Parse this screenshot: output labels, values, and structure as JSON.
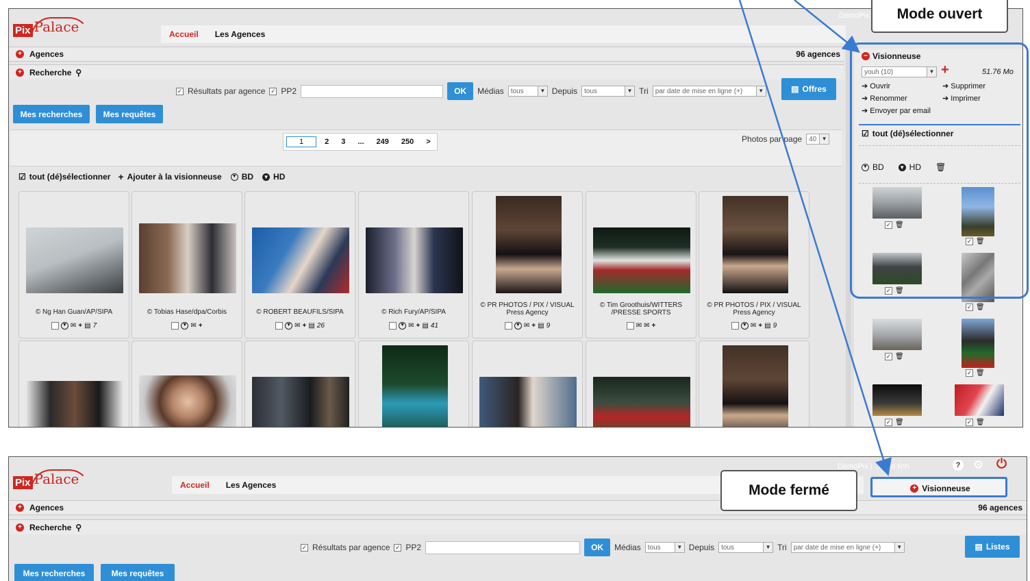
{
  "app": {
    "logo_pix": "Pix",
    "logo_palace": "Palace"
  },
  "top": {
    "user": "DemoPix",
    "tabs": [
      "Accueil",
      "Les Agences"
    ],
    "agences_label": "Agences",
    "agences_count": "96 agences",
    "recherche_label": "Recherche",
    "search": {
      "par_agence": "Résultats par agence",
      "pp2": "PP2",
      "ok": "OK",
      "medias": "Médias",
      "medias_value": "tous",
      "depuis": "Depuis",
      "depuis_value": "tous",
      "tri": "Tri",
      "tri_value": "par date de mise en ligne (+)",
      "offres": "Offres"
    },
    "mes_recherches": "Mes recherches",
    "mes_requetes": "Mes requêtes",
    "pager": [
      "1",
      "2",
      "3",
      "...",
      "249",
      "250",
      ">"
    ],
    "photos_par_page": "Photos par page",
    "photos_par_page_value": "40",
    "toolbar": {
      "select_all": "tout (dé)sélectionner",
      "add": "Ajouter à la visionneuse",
      "bd": "BD",
      "hd": "HD"
    },
    "cards": [
      {
        "caption": "© Ng Han Guan/AP/SIPA",
        "count": "7"
      },
      {
        "caption": "© Tobias Hase/dpa/Corbis",
        "count": ""
      },
      {
        "caption": "© ROBERT BEAUFILS/SIPA",
        "count": "26"
      },
      {
        "caption": "© Rich Fury/AP/SIPA",
        "count": "41"
      },
      {
        "caption": "© PR PHOTOS / PIX / VISUAL Press Agency",
        "count": "9"
      },
      {
        "caption": "© Tim Groothuis/WITTERS /PRESSE SPORTS",
        "count": ""
      },
      {
        "caption": "© PR PHOTOS / PIX / VISUAL Press Agency",
        "count": "9"
      }
    ],
    "viewer": {
      "title": "Visionneuse",
      "selection": "youh (10)",
      "size": "51.76 Mo",
      "ouvrir": "Ouvrir",
      "supprimer": "Supprimer",
      "renommer": "Renommer",
      "imprimer": "Imprimer",
      "envoyer": "Envoyer par email",
      "select_all": "tout (dé)sélectionner",
      "bd": "BD",
      "hd": "HD"
    }
  },
  "callouts": {
    "open": "Mode ouvert",
    "closed": "Mode fermé"
  },
  "bottom": {
    "user_line": "DemoPix | ...e do linh",
    "tabs": [
      "Accueil",
      "Les Agences"
    ],
    "viewer_label": "Visionneuse",
    "agences_label": "Agences",
    "agences_count": "96 agences",
    "recherche_label": "Recherche",
    "search": {
      "par_agence": "Résultats par agence",
      "pp2": "PP2",
      "ok": "OK",
      "medias": "Médias",
      "medias_value": "tous",
      "depuis": "Depuis",
      "depuis_value": "tous",
      "tri": "Tri",
      "tri_value": "par date de mise en ligne (+)",
      "listes": "Listes"
    },
    "mes_recherches": "Mes recherches",
    "mes_requetes": "Mes requêtes"
  },
  "colors": {
    "brand_red": "#d0261f",
    "button_blue": "#2f8fd6",
    "annotation_blue": "#3a7ad3"
  }
}
